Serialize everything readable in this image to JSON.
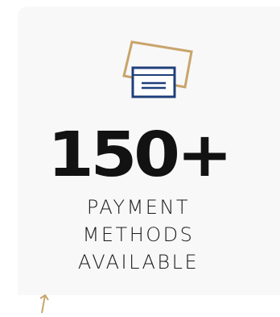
{
  "stat": {
    "value": "150+",
    "label_lines": [
      "PAYMENT",
      "METHODS",
      "AVAILABLE"
    ]
  },
  "icons": {
    "card": "credit-card-icon",
    "arrow": "decorative-arrow-icon"
  },
  "colors": {
    "gold": "#c9a46c",
    "navy": "#1f3f7a",
    "text": "#121212",
    "card_bg": "#f8f8f8"
  }
}
